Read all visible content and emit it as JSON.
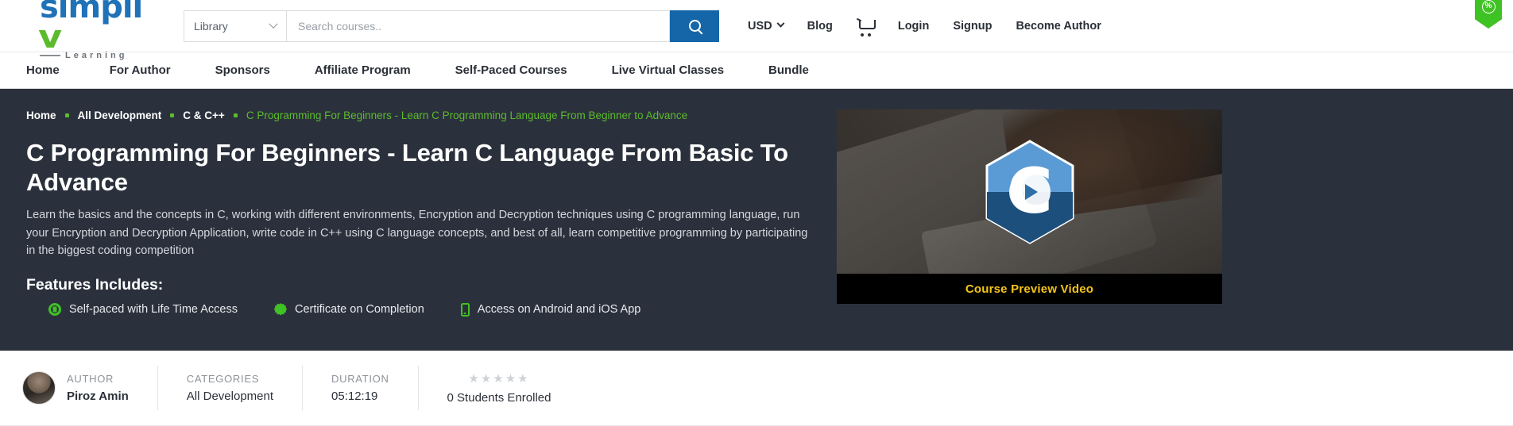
{
  "header": {
    "logo": {
      "main": "simpli",
      "check": "v",
      "sub": "Learning"
    },
    "search": {
      "category_selected": "Library",
      "placeholder": "Search courses..",
      "value": "",
      "button_icon": "search-icon"
    },
    "currency": "USD",
    "links": {
      "blog": "Blog",
      "login": "Login",
      "signup": "Signup",
      "become_author": "Become Author"
    },
    "cart_icon": "shopping-cart-icon",
    "ribbon_icon": "percent-discount-icon"
  },
  "nav": {
    "items": [
      {
        "label": "Home"
      },
      {
        "label": "For Author"
      },
      {
        "label": "Sponsors"
      },
      {
        "label": "Affiliate Program"
      },
      {
        "label": "Self-Paced Courses"
      },
      {
        "label": "Live Virtual Classes"
      },
      {
        "label": "Bundle"
      }
    ]
  },
  "hero": {
    "breadcrumb": [
      {
        "label": "Home",
        "current": false
      },
      {
        "label": "All Development",
        "current": false
      },
      {
        "label": "C & C++",
        "current": false
      },
      {
        "label": "C Programming For Beginners - Learn C Programming Language From Beginner to Advance",
        "current": true
      }
    ],
    "title": "C Programming For Beginners - Learn C Language From Basic To Advance",
    "description": "Learn the basics and the concepts in C, working with different environments, Encryption and Decryption techniques using C programming language, run your Encryption and Decryption Application, write code in C++ using C language concepts, and best of all, learn competitive programming by participating in the biggest coding competition",
    "features_title": "Features Includes:",
    "features": [
      {
        "label": "Self-paced with Life Time Access",
        "icon": "lifebuoy-icon"
      },
      {
        "label": "Certificate on Completion",
        "icon": "certificate-seal-icon"
      },
      {
        "label": "Access on Android and iOS App",
        "icon": "mobile-phone-icon"
      }
    ],
    "video": {
      "preview_label": "Course Preview Video",
      "play_icon": "play-button-icon",
      "logo_icon": "c-language-hexagon-logo"
    }
  },
  "meta": {
    "author": {
      "label": "AUTHOR",
      "value": "Piroz Amin",
      "avatar": "author-avatar"
    },
    "categories": {
      "label": "CATEGORIES",
      "value": "All Development"
    },
    "duration": {
      "label": "DURATION",
      "value": "05:12:19"
    },
    "rating": {
      "stars": "★★★★★",
      "enrolled": "0 Students Enrolled"
    }
  },
  "colors": {
    "brand_blue": "#1566a8",
    "brand_green": "#5cbb2c",
    "hero_bg": "#2b313c",
    "accent_yellow": "#f5c518"
  }
}
